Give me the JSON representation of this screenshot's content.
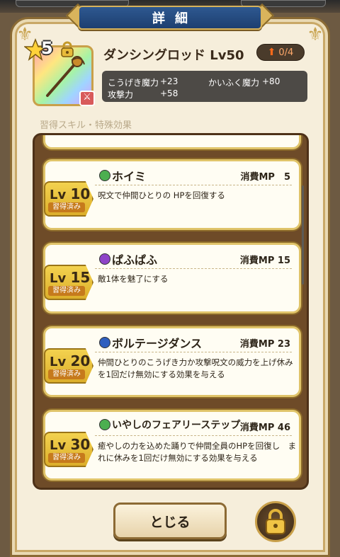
{
  "window": {
    "title": "詳細"
  },
  "item": {
    "stars": "5",
    "name": "ダンシングロッド Lv50",
    "upgrade": "0/4",
    "stats": [
      {
        "label": "こうげき魔力",
        "value": "+23"
      },
      {
        "label": "かいふく魔力",
        "value": "+80"
      },
      {
        "label": "攻撃力",
        "value": "+58"
      }
    ]
  },
  "section": {
    "label": "習得スキル・特殊効果"
  },
  "skills": [
    {
      "lv_prefix": "Lv",
      "lv": "10",
      "learned": "習得済み",
      "name": "ホイミ",
      "mp": "消費MP　5",
      "desc": "呪文で仲間ひとりの HPを回復する",
      "orb_color": "#4caf50"
    },
    {
      "lv_prefix": "Lv",
      "lv": "15",
      "learned": "習得済み",
      "name": "ぱふぱふ",
      "mp": "消費MP 15",
      "desc": "敵1体を魅了にする",
      "orb_color": "#8e44c8"
    },
    {
      "lv_prefix": "Lv",
      "lv": "20",
      "learned": "習得済み",
      "name": "ボルテージダンス",
      "mp": "消費MP 23",
      "desc": "仲間ひとりのこうげき力か攻撃呪文の威力を上げ休みを1回だけ無効にする効果を与える",
      "orb_color": "#2f5fbf"
    },
    {
      "lv_prefix": "Lv",
      "lv": "30",
      "learned": "習得済み",
      "name": "いやしのフェアリーステップ",
      "mp": "消費MP 46",
      "desc": "癒やしの力を込めた踊りで仲間全員のHPを回復し　まれに休みを1回だけ無効にする効果を与える",
      "orb_color": "#4caf50"
    }
  ],
  "buttons": {
    "close": "とじる"
  },
  "icons": {
    "weapon": "staff-icon",
    "lock": "lock-icon",
    "upgrade": "arrow-up-icon"
  }
}
